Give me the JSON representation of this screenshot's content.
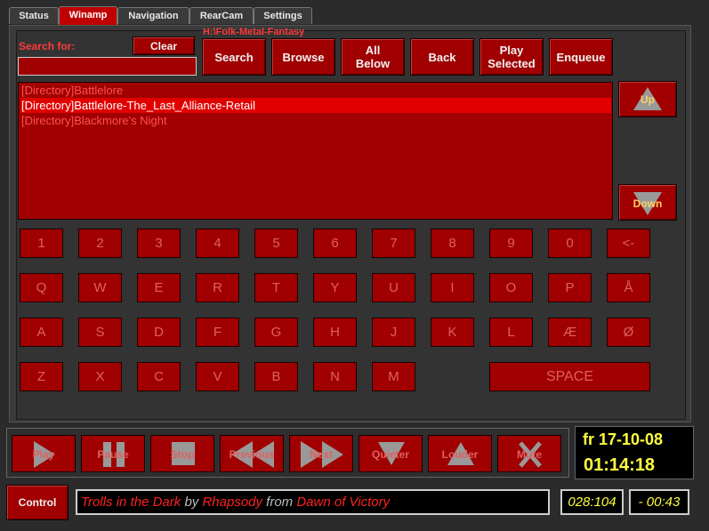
{
  "tabs": [
    {
      "label": "Status",
      "active": false
    },
    {
      "label": "Winamp",
      "active": true
    },
    {
      "label": "Navigation",
      "active": false
    },
    {
      "label": "RearCam",
      "active": false
    },
    {
      "label": "Settings",
      "active": false
    }
  ],
  "path": "H:\\Folk-Metal-Fantasy",
  "search": {
    "label": "Search for:",
    "value": "",
    "clear_label": "Clear"
  },
  "toolbar": {
    "search": "Search",
    "browse": "Browse",
    "all_below": "All Below",
    "back": "Back",
    "play_selected": "Play Selected",
    "enqueue": "Enqueue"
  },
  "nav": {
    "up": "Up",
    "down": "Down"
  },
  "list_items": [
    {
      "text": "[Directory]Battlelore",
      "selected": false
    },
    {
      "text": "[Directory]Battlelore-The_Last_Alliance-Retail",
      "selected": true
    },
    {
      "text": "[Directory]Blackmore's Night",
      "selected": false
    }
  ],
  "keyboard": {
    "row1": [
      "1",
      "2",
      "3",
      "4",
      "5",
      "6",
      "7",
      "8",
      "9",
      "0",
      "<-"
    ],
    "row2": [
      "Q",
      "W",
      "E",
      "R",
      "T",
      "Y",
      "U",
      "I",
      "O",
      "P",
      "Å"
    ],
    "row3": [
      "A",
      "S",
      "D",
      "F",
      "G",
      "H",
      "J",
      "K",
      "L",
      "Æ",
      "Ø"
    ],
    "row4": [
      "Z",
      "X",
      "C",
      "V",
      "B",
      "N",
      "M"
    ],
    "space": "SPACE"
  },
  "transport": {
    "play": "Play",
    "pause": "Pause",
    "stop": "Stop",
    "previous": "Previous",
    "next": "Next",
    "quieter": "Quieter",
    "louder": "Louder",
    "mute": "Mute"
  },
  "clock": {
    "date": "fr 17-10-08",
    "time": "01:14:18"
  },
  "control_label": "Control",
  "now_playing": {
    "title": "Trolls in the Dark",
    "by": "by",
    "artist": "Rhapsody",
    "from": "from",
    "album": "Dawn of Victory"
  },
  "playlist_pos": "028:104",
  "remaining": "- 00:43",
  "colors": {
    "accent_red": "#a00000",
    "selected_red": "#e00000",
    "clock_yellow": "#ffff40"
  }
}
